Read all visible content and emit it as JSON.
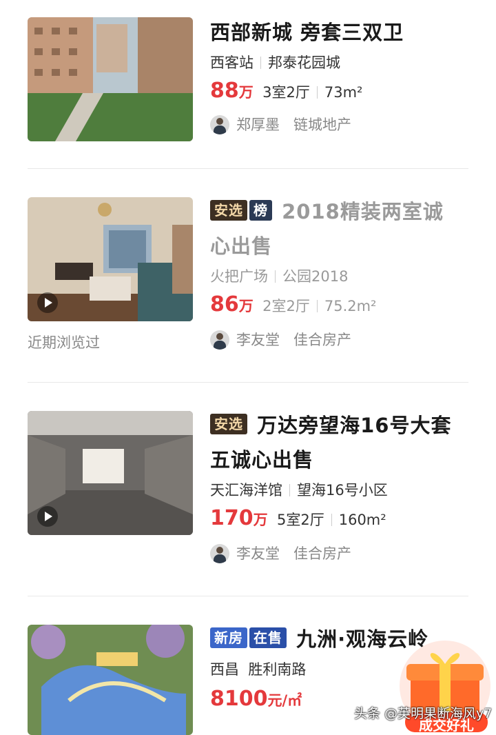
{
  "listings": [
    {
      "title": "西部新城  旁套三双卫",
      "area": "西客站",
      "community": "邦泰花园城",
      "price": "88",
      "price_unit": "万",
      "layout": "3室2厅",
      "size": "73m²",
      "agent": "郑厚墨",
      "agency": "链城地产"
    },
    {
      "tags": [
        "安选",
        "榜"
      ],
      "title_line1": "2018精装两室诚",
      "title_line2": "心出售",
      "area": "火把广场",
      "community": "公园2018",
      "price": "86",
      "price_unit": "万",
      "layout": "2室2厅",
      "size": "75.2m²",
      "agent": "李友堂",
      "agency": "佳合房产",
      "viewed_note": "近期浏览过"
    },
    {
      "tags": [
        "安选"
      ],
      "title_line1": "万达旁望海16号大套",
      "title_line2": "五诚心出售",
      "area": "天汇海洋馆",
      "community": "望海16号小区",
      "price": "170",
      "price_unit": "万",
      "layout": "5室2厅",
      "size": "160m²",
      "agent": "李友堂",
      "agency": "佳合房产"
    },
    {
      "tags": [
        "新房",
        "在售"
      ],
      "title": "九洲·观海云岭",
      "area": "西昌",
      "community": "胜利南路",
      "price": "8100",
      "price_unit": "元/㎡"
    }
  ],
  "promo": {
    "label": "成交好礼"
  },
  "watermark": "头条 @英明果断海风y7",
  "colors": {
    "price": "#e4393c",
    "tag_dark": "#3d2f22",
    "tag_new": "#3b66c9"
  }
}
